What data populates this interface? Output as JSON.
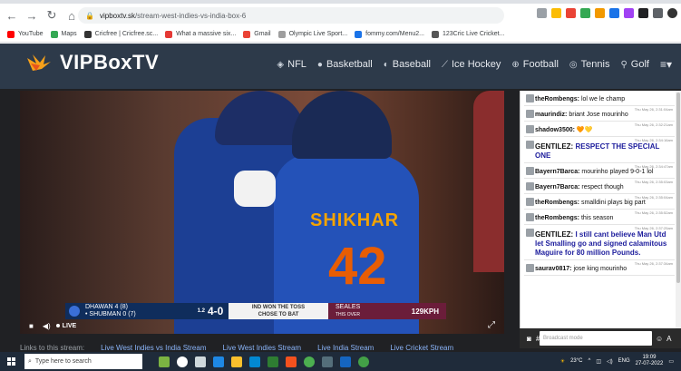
{
  "browser": {
    "url_host": "vipboxtv.sk",
    "url_path": "/stream-west-indies-vs-india-box-6",
    "bookmarks": [
      {
        "label": "YouTube",
        "color": "#ff0000"
      },
      {
        "label": "Maps",
        "color": "#34a853"
      },
      {
        "label": "Cricfree | Cricfree.sc...",
        "color": "#333333"
      },
      {
        "label": "What a massive six...",
        "color": "#e53935"
      },
      {
        "label": "Gmail",
        "color": "#ea4335"
      },
      {
        "label": "Olympic Live Sport...",
        "color": "#9e9e9e"
      },
      {
        "label": "fommy.com/Menu2...",
        "color": "#1a73e8"
      },
      {
        "label": "123Cric Live Cricket...",
        "color": "#555555"
      }
    ]
  },
  "site": {
    "logo": "VIPBoxTV",
    "nav": [
      {
        "label": "NFL",
        "icon": "football-icon"
      },
      {
        "label": "Basketball",
        "icon": "basketball-icon"
      },
      {
        "label": "Baseball",
        "icon": "baseball-icon"
      },
      {
        "label": "Ice Hockey",
        "icon": "hockey-icon"
      },
      {
        "label": "Football",
        "icon": "soccer-icon"
      },
      {
        "label": "Tennis",
        "icon": "tennis-icon"
      },
      {
        "label": "Golf",
        "icon": "golf-icon"
      }
    ]
  },
  "player": {
    "jersey_name": "SHIKHAR",
    "jersey_number": "42",
    "score": {
      "batter1": "DHAWAN",
      "batter1_runs": "4 (8)",
      "batter2": "• SHUBMAN",
      "batter2_runs": "0 (7)",
      "overs": "1.2",
      "total": "4-0",
      "toss_line1": "IND WON THE TOSS",
      "toss_line2": "CHOSE TO BAT",
      "bowler": "SEALES",
      "this_over": "THIS OVER",
      "speed": "129KPH"
    },
    "live_label": "LIVE"
  },
  "chat": {
    "messages": [
      {
        "time": "",
        "user": "theRombengs:",
        "text": "lol we le champ",
        "big": false
      },
      {
        "time": "Thu May 26, 2:31:04am",
        "user": "maurindiz:",
        "text": "briant Jose mourinho",
        "big": false
      },
      {
        "time": "Thu May 26, 2:32:21am",
        "user": "shadow3500:",
        "text": "🧡💛",
        "big": false
      },
      {
        "time": "Thu May 26, 2:34:16am",
        "user": "GENTILEZ:",
        "text": "RESPECT THE SPECIAL ONE",
        "big": true
      },
      {
        "time": "Thu May 26, 2:34:47am",
        "user": "Bayern7Barca:",
        "text": "mourinho played 9-0-1 lol",
        "big": false
      },
      {
        "time": "Thu May 26, 2:35:03am",
        "user": "Bayern7Barca:",
        "text": "respect though",
        "big": false
      },
      {
        "time": "Thu May 26, 2:35:04am",
        "user": "theRombengs:",
        "text": "smalldini plays big part",
        "big": false
      },
      {
        "time": "Thu May 26, 2:35:52am",
        "user": "theRombengs:",
        "text": "this season",
        "big": false
      },
      {
        "time": "Thu May 26, 2:37:25am",
        "user": "GENTILEZ:",
        "text": "I still cant believe Man Utd let Smalling go and signed calamitous Maguire for 80 million Pounds.",
        "big": true
      },
      {
        "time": "Thu May 26, 2:37:34am",
        "user": "saurav0817:",
        "text": "jose king mourinho",
        "big": false
      }
    ],
    "input_placeholder": "Broadcast mode"
  },
  "links": {
    "label": "Links to this stream:",
    "items": [
      "Live West Indies vs India Stream",
      "Live West Indies Stream",
      "Live India Stream",
      "Live Cricket Stream"
    ]
  },
  "taskbar": {
    "search_placeholder": "Type here to search",
    "weather": "23°C",
    "lang": "ENG",
    "time": "19:09",
    "date": "27-07-2022"
  }
}
